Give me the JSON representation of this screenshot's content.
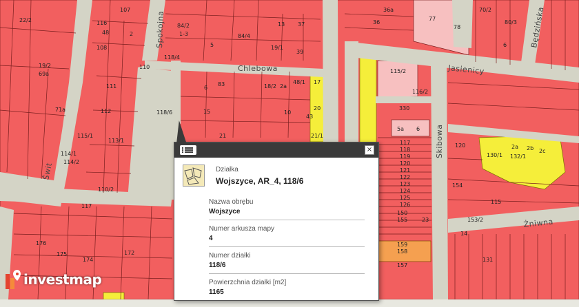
{
  "map": {
    "streets": {
      "chlebowa": "Chlebowa",
      "jasienicy": "Jasienicy",
      "spokojna": "Spokojna",
      "bedzinska": "Będzińska",
      "skibowa": "Skibowa",
      "zniwna": "Żniwna",
      "swit": "Świt"
    },
    "parcel_numbers": {
      "p1": "22/2",
      "p2": "107",
      "p3": "116",
      "p4": "48",
      "p5": "108",
      "p6": "84/2",
      "p7": "1-3",
      "p8": "2",
      "p9": "84/4",
      "p10": "37",
      "p11": "5",
      "p12": "13",
      "p13": "19/1",
      "p14": "39",
      "p15": "36",
      "p16": "36a",
      "p17": "77",
      "p18": "78",
      "p19": "70/2",
      "p20": "80/3",
      "p21": "118/4",
      "p22": "19/2",
      "p23": "69a",
      "p24": "110",
      "p25": "111",
      "p26": "6",
      "p27": "83",
      "p28": "18/2",
      "p29": "2a",
      "p30": "48/1",
      "p31": "17",
      "p32": "115/2",
      "p33": "116/2",
      "p34": "118/6",
      "p35": "71a",
      "p36": "112",
      "p37": "15",
      "p38": "10",
      "p39": "20",
      "p40": "43",
      "p41": "330",
      "p42": "5a",
      "p43": "6",
      "p44": "113/1",
      "p45": "114/1",
      "p46": "114/2",
      "p47": "115/1",
      "p48": "21",
      "p49": "21/1",
      "p50": "117",
      "p51": "118",
      "p52": "119",
      "p53": "120",
      "p54": "121",
      "p55": "122",
      "p56": "123",
      "p57": "124",
      "p58": "125",
      "p59": "126",
      "p60": "120",
      "p61": "2a",
      "p62": "2b",
      "p63": "2c",
      "p64": "132/1",
      "p65": "130/1",
      "p66": "154",
      "p67": "153/2",
      "p68": "115",
      "p69": "117",
      "p70": "176",
      "p71": "175",
      "p72": "174",
      "p73": "172",
      "p74": "159",
      "p75": "158",
      "p76": "157",
      "p77": "150",
      "p78": "155",
      "p79": "23",
      "p80": "14",
      "p81": "131",
      "p82": "110/2",
      "p83": "6"
    }
  },
  "popup": {
    "type_label": "Działka",
    "title": "Wojszyce, AR_4, 118/6",
    "close_glyph": "×",
    "fields": [
      {
        "label": "Nazwa obrębu",
        "value": "Wojszyce"
      },
      {
        "label": "Numer arkusza mapy",
        "value": "4"
      },
      {
        "label": "Numer działki",
        "value": "118/6"
      },
      {
        "label": "Powierzchnia działki [m2]",
        "value": "1165"
      }
    ]
  },
  "logo": {
    "text": "investmap",
    "mark_colors": [
      "#e4432f",
      "#f58a3a"
    ]
  },
  "colors": {
    "plot": "#f25f5f",
    "plot_yellow": "#f5ee3a",
    "road": "#d4d4c6",
    "popup_header": "#3a3a3a"
  },
  "icons": {
    "list": "list-icon",
    "close": "close-icon",
    "parcel": "parcel-thumbnail-icon",
    "logo": "investmap-logo-icon"
  }
}
